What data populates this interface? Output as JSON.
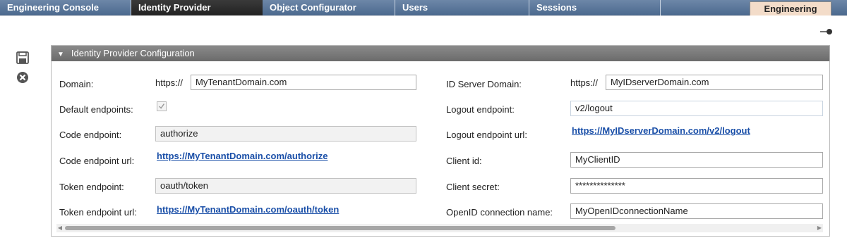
{
  "nav": {
    "tabs": [
      {
        "label": "Engineering Console"
      },
      {
        "label": "Identity Provider"
      },
      {
        "label": "Object Configurator"
      },
      {
        "label": "Users"
      },
      {
        "label": "Sessions"
      }
    ],
    "right_tab": "Engineering"
  },
  "toolbar": {
    "save_icon": "save-icon",
    "close_icon": "close-icon",
    "pin_icon": "pin-icon"
  },
  "panel": {
    "title": "Identity Provider Configuration",
    "left": {
      "domain_label": "Domain:",
      "domain_prefix": "https://",
      "domain_value": "MyTenantDomain.com",
      "default_endpoints_label": "Default endpoints:",
      "default_endpoints_checked": true,
      "code_endpoint_label": "Code endpoint:",
      "code_endpoint_value": "authorize",
      "code_endpoint_url_label": "Code endpoint url:",
      "code_endpoint_url": "https://MyTenantDomain.com/authorize",
      "token_endpoint_label": "Token endpoint:",
      "token_endpoint_value": "oauth/token",
      "token_endpoint_url_label": "Token endpoint url:",
      "token_endpoint_url": "https://MyTenantDomain.com/oauth/token"
    },
    "right": {
      "id_server_domain_label": "ID Server Domain:",
      "id_server_prefix": "https://",
      "id_server_domain_value": "MyIDserverDomain.com",
      "logout_endpoint_label": "Logout endpoint:",
      "logout_endpoint_value": "v2/logout",
      "logout_endpoint_url_label": "Logout endpoint url:",
      "logout_endpoint_url": "https://MyIDserverDomain.com/v2/logout",
      "client_id_label": "Client id:",
      "client_id_value": "MyClientID",
      "client_secret_label": "Client secret:",
      "client_secret_value": "**************",
      "openid_connection_label": "OpenID connection name:",
      "openid_connection_value": "MyOpenIDconnectionName"
    }
  },
  "colors": {
    "nav_bg": "#5a7699",
    "active_tab": "#2a2a2a",
    "eng_tab": "#f3dcc9",
    "link": "#1a4fa8",
    "panel_header": "#777777"
  }
}
